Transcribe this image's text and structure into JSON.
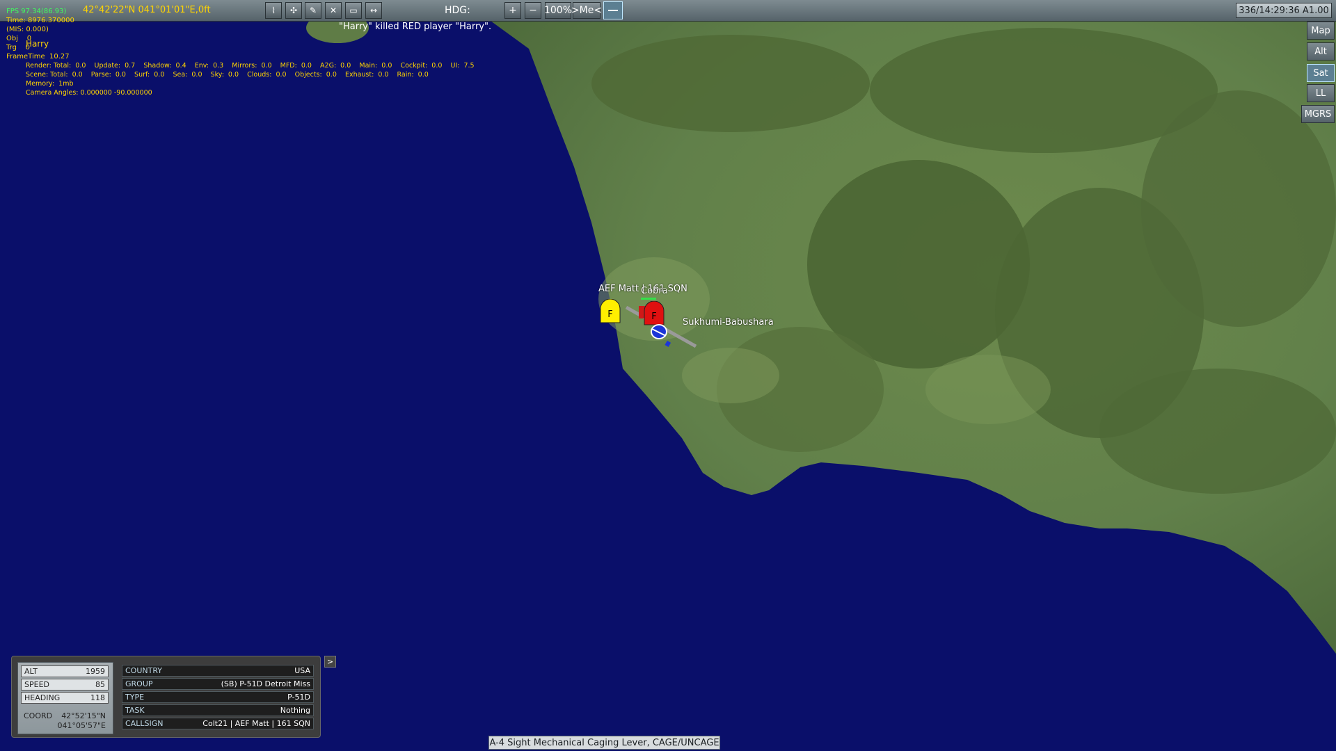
{
  "topbar": {
    "coords": "42°42'22\"N 041°01'01\"E,0ft",
    "hdg_label": "HDG:",
    "zoom_in": "+",
    "zoom_out": "−",
    "zoom_pct": "100%",
    "follow_me": ">Me<",
    "clock": "336/14:29:36 A1.00",
    "tool_icons": [
      "route-icon",
      "target-icon",
      "unit-edit-icon",
      "delete-icon",
      "comment-icon",
      "ruler-icon"
    ]
  },
  "debug": {
    "fps": "FPS 97.34(86.93)",
    "time": "Time: 8976.370000",
    "mis": "(MIS: 0.000)",
    "obj": "Obj    0",
    "trg": "Trg    0",
    "frametime": "FrameTime  10.27",
    "render": "Render: Total:  0.0    Update:  0.7    Shadow:  0.4    Env:  0.3    Mirrors:  0.0    MFD:  0.0    A2G:  0.0    Main:  0.0    Cockpit:  0.0    UI:  7.5",
    "scene": "Scene: Total:  0.0    Parse:  0.0    Surf:  0.0    Sea:  0.0    Sky:  0.0    Clouds:  0.0    Objects:  0.0    Exhaust:  0.0    Rain:  0.0",
    "memory": "Memory:  1mb",
    "camera": "Camera Angles: 0.000000 -90.000000"
  },
  "player_name": "Harry",
  "kill_message": "\"Harry\" killed RED player \"Harry\".",
  "layers": [
    "Map",
    "Alt",
    "Sat",
    "LL",
    "MGRS"
  ],
  "active_layer": "Sat",
  "map_labels": {
    "unit_label": "AEF Matt | 161 SQN",
    "unit_label_overlap": "Cobra",
    "airfield": "Sukhumi-Babushara",
    "marker_yellow": "F",
    "marker_red": "F"
  },
  "info_panel": {
    "left": [
      {
        "label": "ALT",
        "value": "1959"
      },
      {
        "label": "SPEED",
        "value": "85"
      },
      {
        "label": "HEADING",
        "value": "118"
      }
    ],
    "coord_label": "COORD",
    "coord_lat": "42°52'15\"N",
    "coord_lon": "041°05'57\"E",
    "right": [
      {
        "label": "COUNTRY",
        "value": "USA"
      },
      {
        "label": "GROUP",
        "value": "(SB) P-51D Detroit Miss"
      },
      {
        "label": "TYPE",
        "value": "P-51D"
      },
      {
        "label": "TASK",
        "value": "Nothing"
      },
      {
        "label": "CALLSIGN",
        "value": "Colt21 | AEF Matt | 161 SQN"
      }
    ],
    "expand": ">"
  },
  "status_text": "A-4 Sight Mechanical Caging Lever, CAGE/UNCAGE",
  "colors": {
    "sea": "#0a0f6a",
    "land": "#6f8a4a",
    "forest": "#4f6a38",
    "debug_text": "#ffd400",
    "marker_yellow": "#ffee00",
    "marker_red": "#e01010"
  }
}
